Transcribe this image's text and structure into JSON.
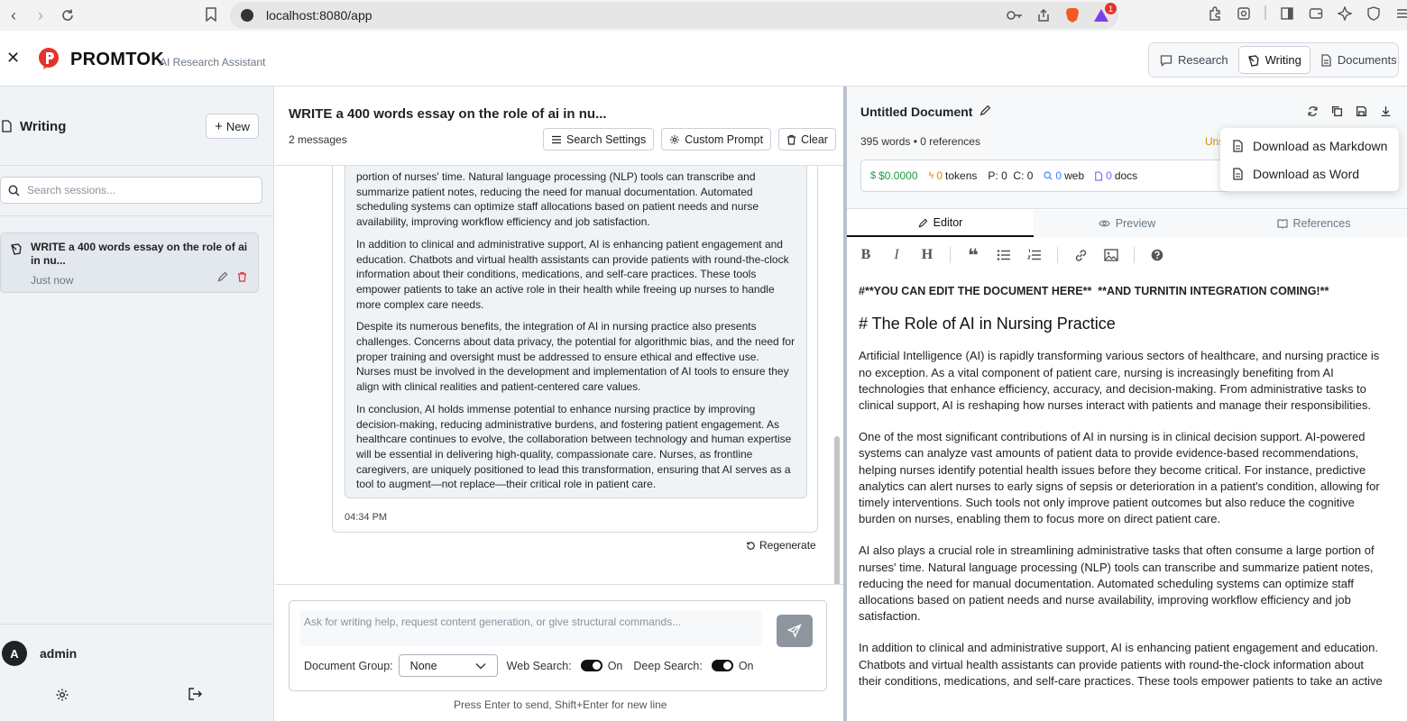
{
  "browser": {
    "url": "localhost:8080/app",
    "brave_badge": "1"
  },
  "header": {
    "brand": "PROMTOK",
    "subtitle": "AI Research Assistant",
    "tabs": [
      {
        "label": "Research",
        "icon": "chat-icon"
      },
      {
        "label": "Writing",
        "icon": "pen-icon"
      },
      {
        "label": "Documents",
        "icon": "document-icon"
      }
    ],
    "active_tab": "Writing"
  },
  "sidebar": {
    "title": "Writing",
    "new_label": "New",
    "search_placeholder": "Search sessions...",
    "sessions": [
      {
        "title": "WRITE a 400 words essay on the role of ai in nu...",
        "time": "Just now"
      }
    ],
    "user": {
      "initial": "A",
      "name": "admin"
    }
  },
  "chat": {
    "title": "WRITE a 400 words essay on the role of ai in nu...",
    "message_count": "2 messages",
    "actions": {
      "search_settings": "Search Settings",
      "custom_prompt": "Custom Prompt",
      "clear": "Clear"
    },
    "message_paragraphs": [
      "portion of nurses' time. Natural language processing (NLP) tools can transcribe and summarize patient notes, reducing the need for manual documentation. Automated scheduling systems can optimize staff allocations based on patient needs and nurse availability, improving workflow efficiency and job satisfaction.",
      "In addition to clinical and administrative support, AI is enhancing patient engagement and education. Chatbots and virtual health assistants can provide patients with round-the-clock information about their conditions, medications, and self-care practices. These tools empower patients to take an active role in their health while freeing up nurses to handle more complex care needs.",
      "Despite its numerous benefits, the integration of AI in nursing practice also presents challenges. Concerns about data privacy, the potential for algorithmic bias, and the need for proper training and oversight must be addressed to ensure ethical and effective use. Nurses must be involved in the development and implementation of AI tools to ensure they align with clinical realities and patient-centered care values.",
      "In conclusion, AI holds immense potential to enhance nursing practice by improving decision-making, reducing administrative burdens, and fostering patient engagement. As healthcare continues to evolve, the collaboration between technology and human expertise will be essential in delivering high-quality, compassionate care. Nurses, as frontline caregivers, are uniquely positioned to lead this transformation, ensuring that AI serves as a tool to augment—not replace—their critical role in patient care."
    ],
    "message_time": "04:34 PM",
    "regenerate": "Regenerate",
    "input_placeholder": "Ask for writing help, request content generation, or give structural commands...",
    "document_group_label": "Document Group:",
    "document_group_value": "None",
    "web_search_label": "Web Search:",
    "web_search_state": "On",
    "deep_search_label": "Deep Search:",
    "deep_search_state": "On",
    "hint": "Press Enter to send, Shift+Enter for new line"
  },
  "document": {
    "title": "Untitled Document",
    "meta": "395 words • 0 references",
    "unsaved": "Uns",
    "stats": {
      "cost": "$0.0000",
      "tokens": "0",
      "tokens_label": "tokens",
      "pc": "P: 0  C: 0",
      "web": "0",
      "web_label": "web",
      "docs": "0",
      "docs_label": "docs"
    },
    "tabs": {
      "editor": "Editor",
      "preview": "Preview",
      "references": "References"
    },
    "notice": "#**YOU CAN EDIT THE DOCUMENT HERE**  **AND TURNITIN INTEGRATION COMING!**",
    "heading": "# The Role of AI in Nursing Practice",
    "paragraphs": [
      "Artificial Intelligence (AI) is rapidly transforming various sectors of healthcare, and nursing practice is no exception. As a vital component of patient care, nursing is increasingly benefiting from AI technologies that enhance efficiency, accuracy, and decision-making. From administrative tasks to clinical support, AI is reshaping how nurses interact with patients and manage their responsibilities.",
      "One of the most significant contributions of AI in nursing is in clinical decision support. AI-powered systems can analyze vast amounts of patient data to provide evidence-based recommendations, helping nurses identify potential health issues before they become critical. For instance, predictive analytics can alert nurses to early signs of sepsis or deterioration in a patient's condition, allowing for timely interventions. Such tools not only improve patient outcomes but also reduce the cognitive burden on nurses, enabling them to focus more on direct patient care.",
      "AI also plays a crucial role in streamlining administrative tasks that often consume a large portion of nurses' time. Natural language processing (NLP) tools can transcribe and summarize patient notes, reducing the need for manual documentation. Automated scheduling systems can optimize staff allocations based on patient needs and nurse availability, improving workflow efficiency and job satisfaction.",
      "In addition to clinical and administrative support, AI is enhancing patient engagement and education. Chatbots and virtual health assistants can provide patients with round-the-clock information about their conditions, medications, and self-care practices. These tools empower patients to take an active"
    ],
    "download_menu": [
      "Download as Markdown",
      "Download as Word"
    ]
  },
  "colors": {
    "accent_red": "#e5322d",
    "cost_green": "#1a9e3f",
    "tokens_orange": "#e58a00",
    "web_blue": "#3b82f6",
    "docs_purple": "#8b5cf6",
    "unsaved_orange": "#d98a00"
  }
}
